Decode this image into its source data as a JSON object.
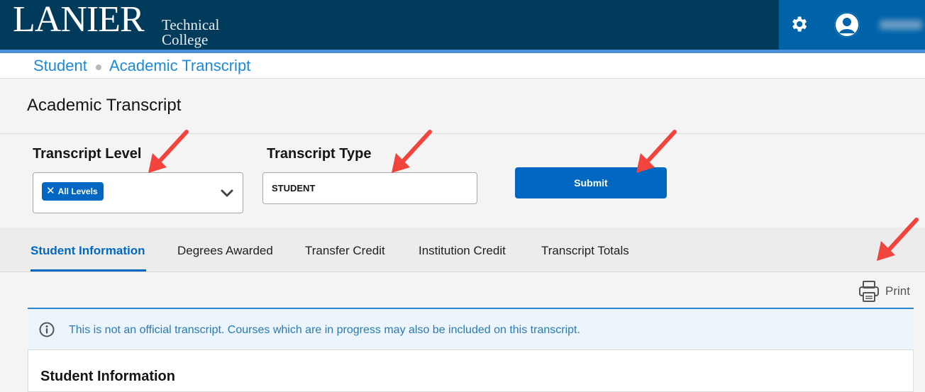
{
  "header": {
    "logo_main": "LANIER",
    "logo_sub1": "Technical",
    "logo_sub2": "College",
    "settings_icon": "gear-icon",
    "profile_icon": "user-avatar-icon"
  },
  "breadcrumb": {
    "items": [
      "Student",
      "Academic Transcript"
    ]
  },
  "page": {
    "title": "Academic Transcript"
  },
  "form": {
    "level_label": "Transcript Level",
    "level_selected_chip": "All Levels",
    "type_label": "Transcript Type",
    "type_value": "STUDENT",
    "submit_label": "Submit"
  },
  "tabs": [
    {
      "label": "Student Information",
      "active": true
    },
    {
      "label": "Degrees Awarded",
      "active": false
    },
    {
      "label": "Transfer Credit",
      "active": false
    },
    {
      "label": "Institution Credit",
      "active": false
    },
    {
      "label": "Transcript Totals",
      "active": false
    }
  ],
  "content": {
    "print_label": "Print",
    "notice_text": "This is not an official transcript. Courses which are in progress may also be included on this transcript.",
    "section_title": "Student Information"
  },
  "colors": {
    "header_bg": "#003b5c",
    "accent_blue": "#0068c2",
    "link_blue": "#1d8ad6",
    "annotation_arrow": "#f0443c"
  }
}
